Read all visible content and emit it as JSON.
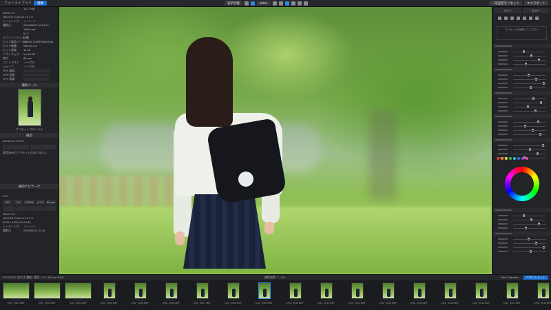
{
  "app": {
    "title": "フォトライブラリ",
    "mode_badge": "現像"
  },
  "toolbar": {
    "view_label": "表示切替",
    "zoom": "100%",
    "preset_label": "一括設定をリセット",
    "export_label": "エクスポート"
  },
  "left_panel": {
    "header_size": "111.7 MB",
    "meta_rows": [
      {
        "label": "Nikon Z 8",
        "value": ""
      },
      {
        "label": "NIKKOR Z 85mm f/1.2 S",
        "value": ""
      },
      {
        "label": "レーティング",
        "value": "☆☆☆☆☆"
      },
      {
        "label": "撮影日",
        "value": "2024/05/22 10:44:17"
      },
      {
        "label": "",
        "value": "1/640 sec"
      },
      {
        "label": "",
        "value": "f/1.2"
      },
      {
        "label": "ホワイトバランス",
        "value": "自動"
      },
      {
        "label": "カメラ製造メーカー",
        "value": "NIKON CORPORATION"
      },
      {
        "label": "カメラ機種",
        "value": "NIKON Z 8"
      },
      {
        "label": "ビット深度",
        "value": "14 bit"
      },
      {
        "label": "ソフトウェア",
        "value": "Ver.01.00"
      },
      {
        "label": "焦点",
        "value": "85 mm"
      },
      {
        "label": "コントラスト",
        "value": "ノーマル"
      },
      {
        "label": "シャープ",
        "value": "ノーマル"
      },
      {
        "label": "GPS 緯度",
        "value": ""
      },
      {
        "label": "GPS 経度",
        "value": ""
      },
      {
        "label": "GPS 高度",
        "value": ""
      }
    ],
    "preview_section": "補助ツール",
    "preview_title": "プリセットマネージャ",
    "advanced_section": "補足",
    "advanced_label": "Advanced Preset",
    "advanced_hint": "適用済みのプリセットはありません",
    "tools_section": "補助ナビゲータ",
    "shoot_section": "Exif",
    "shoot_values": [
      "ISO 100",
      "1/1",
      "1/2000s",
      "ƒ/1.2",
      "85 mm"
    ],
    "bottom_rows": [
      {
        "label": "Nikon Z 8",
        "value": ""
      },
      {
        "label": "NIKKOR Z 85mm f/1.2 S",
        "value": ""
      },
      {
        "label": "6048 x 4032 (24.4 MP)",
        "value": ""
      },
      {
        "label": "レーティング",
        "value": "☆☆☆☆☆"
      },
      {
        "label": "撮影日",
        "value": "2024/05/22 10:44"
      }
    ]
  },
  "right_panel": {
    "top_buttons": [
      "ライト",
      "カラー"
    ],
    "preset_note": "プリセットを適用してください",
    "sections": [
      "ライト",
      "カラー",
      "ディテール",
      "効果",
      "カラーミキサー"
    ],
    "swatch_colors": [
      "#e23b3b",
      "#f08a24",
      "#f2d13a",
      "#46b34a",
      "#2ec4c4",
      "#2e6fe8",
      "#9b43d8",
      "#e84bb2"
    ]
  },
  "filmstrip": {
    "folder_path": "2024/05/22 女の子 撮影 / 横浜 / Z 8 / 85 mm RAW",
    "count_label": "撮影枚数",
    "count_value": "1 / 204",
    "tabs": [
      {
        "label": "Film Collection",
        "active": false
      },
      {
        "label": "ベストショット",
        "active": true
      }
    ],
    "items": [
      {
        "name": "DSC_0001.NEF",
        "kind": "land",
        "selected": false
      },
      {
        "name": "DSC_0002.NEF",
        "kind": "land",
        "selected": false
      },
      {
        "name": "DSC_0003.NEF",
        "kind": "land",
        "selected": false
      },
      {
        "name": "DSC_0004.NEF",
        "kind": "port",
        "selected": false
      },
      {
        "name": "DSC_0005.NEF",
        "kind": "port",
        "selected": false
      },
      {
        "name": "DSC_0006.NEF",
        "kind": "port",
        "selected": false
      },
      {
        "name": "DSC_0007.NEF",
        "kind": "port",
        "selected": false
      },
      {
        "name": "DSC_0008.NEF",
        "kind": "port",
        "selected": false
      },
      {
        "name": "DSC_0009.NEF",
        "kind": "port",
        "selected": true
      },
      {
        "name": "DSC_0010.NEF",
        "kind": "port",
        "selected": false
      },
      {
        "name": "DSC_0011.NEF",
        "kind": "port",
        "selected": false
      },
      {
        "name": "DSC_0012.NEF",
        "kind": "port",
        "selected": false
      },
      {
        "name": "DSC_0013.NEF",
        "kind": "port",
        "selected": false
      },
      {
        "name": "DSC_0014.NEF",
        "kind": "port",
        "selected": false
      },
      {
        "name": "DSC_0015.NEF",
        "kind": "port",
        "selected": false
      },
      {
        "name": "DSC_0016.NEF",
        "kind": "port",
        "selected": false
      },
      {
        "name": "DSC_0017.NEF",
        "kind": "port",
        "selected": false
      },
      {
        "name": "DSC_0018.NEF",
        "kind": "port",
        "selected": false
      }
    ]
  }
}
